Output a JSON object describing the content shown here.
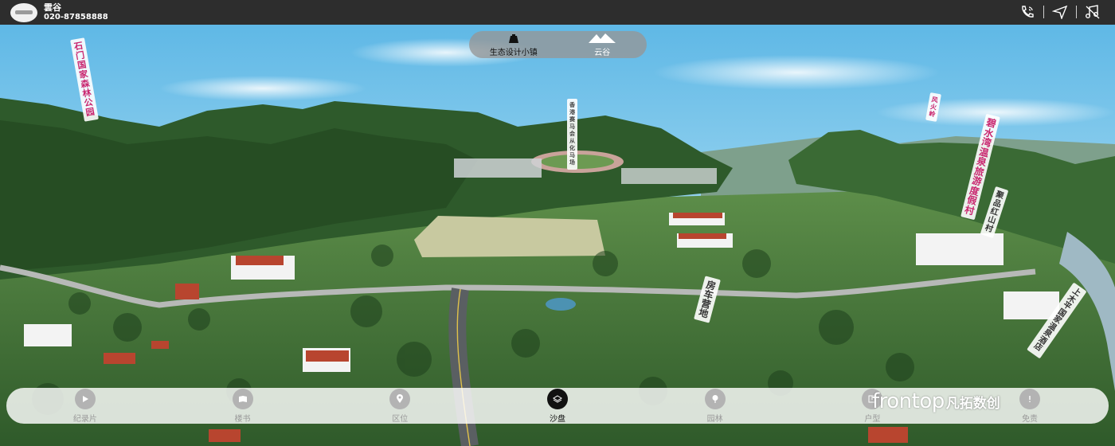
{
  "header": {
    "name": "雲谷",
    "phone": "020-87858888",
    "actions": [
      "phone-icon",
      "navigate-icon",
      "music-icon"
    ]
  },
  "switcher": {
    "left_label": "生态设计小镇",
    "right_label": "云谷"
  },
  "map_labels": [
    "石门国家森林公园",
    "香港赛马会从化马场",
    "风火岭",
    "碧水湾温泉旅游度假村",
    "聚品红山村",
    "房车营地",
    "上木平国家温泉酒店"
  ],
  "nav": {
    "items": [
      {
        "label": "纪录片",
        "icon": "play-icon"
      },
      {
        "label": "楼书",
        "icon": "book-icon"
      },
      {
        "label": "区位",
        "icon": "location-icon"
      },
      {
        "label": "沙盘",
        "icon": "sandbox-icon"
      },
      {
        "label": "园林",
        "icon": "tree-icon"
      },
      {
        "label": "户型",
        "icon": "floorplan-icon"
      },
      {
        "label": "免责",
        "icon": "disclaimer-icon"
      }
    ],
    "active": "沙盘"
  },
  "watermark": {
    "en": "frontop",
    "cn": "凡拓数创"
  },
  "colors": {
    "topbar": "#2d2d2d",
    "tag_text": "#c9266f",
    "sky": "#8fd0ee",
    "forest": "#2f5a2a"
  }
}
